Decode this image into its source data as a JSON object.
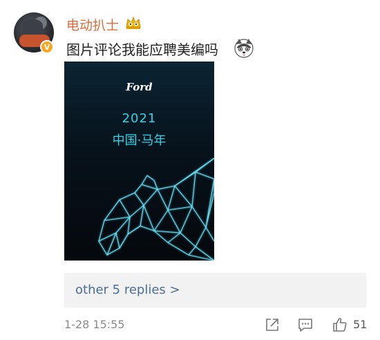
{
  "comment": {
    "username": "电动扒士",
    "text": "图片评论我能应聘美编吗",
    "verified_badge": "V",
    "icons": {
      "crown": "crown-badge-icon",
      "emoji": "husky-emoji-icon"
    }
  },
  "poster": {
    "brand": "Ford",
    "year": "2021",
    "title": "中国·马年",
    "accent_color": "#2bd5ea"
  },
  "replies": {
    "link_text": "other 5 replies >"
  },
  "footer": {
    "timestamp": "1-28 15:55",
    "like_count": "51",
    "icons": {
      "share": "share-icon",
      "comment": "comment-icon",
      "like": "thumbs-up-icon"
    }
  },
  "colors": {
    "username": "#e06a3a",
    "link": "#4a6f95",
    "meta": "#8a8a8a"
  }
}
